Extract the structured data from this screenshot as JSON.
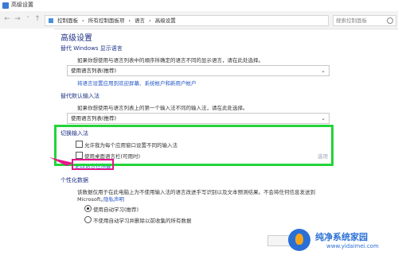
{
  "window": {
    "title": "高级设置"
  },
  "address": {
    "crumbs": [
      "控制面板",
      "所有控制面板项",
      "语言",
      "高级设置"
    ],
    "search_placeholder": "搜索控制面板"
  },
  "page": {
    "title": "高级设置"
  },
  "display_language": {
    "heading": "替代 Windows 显示语言",
    "desc": "如果你想使用与语言列表中的顺序所确定的语言不同的显示语言，请在此处选择。",
    "value": "使用语言列表(推荐)",
    "link": "将语言设置应用到欢迎屏幕、系统帐户和新用户帐户"
  },
  "input_method": {
    "heading": "替代默认输入法",
    "desc": "如果你想使用与语言列表上的第一个输入法不同的输入法，请在此处选择。",
    "value": "使用语言列表(推荐)"
  },
  "switch_input": {
    "heading": "切换输入法",
    "option1": "允许我为每个应用窗口设置不同的输入法",
    "option2": "使用桌面语言栏(可用时)",
    "options_link": "选项",
    "change_hotkeys": "更改语言栏热键"
  },
  "personalization": {
    "heading": "个性化数据",
    "desc1": "该数据仅用于在此电脑上为不使用输入法的语言改进手写识别以及文本预测结果。不会将任何信息发送到",
    "desc2_prefix": "Microsoft。",
    "privacy_link": "隐私声明",
    "radio1": "使用自动学习(推荐)",
    "radio2": "不使用自动学习并删除以前收集的所有数据"
  },
  "watermark": {
    "brand": "纯净系统家园",
    "url": "www.yidaimei.com"
  },
  "colors": {
    "highlight_green": "#22d43a",
    "highlight_pink": "#e8168a",
    "link": "#2457c8",
    "heading": "#1e3287"
  }
}
